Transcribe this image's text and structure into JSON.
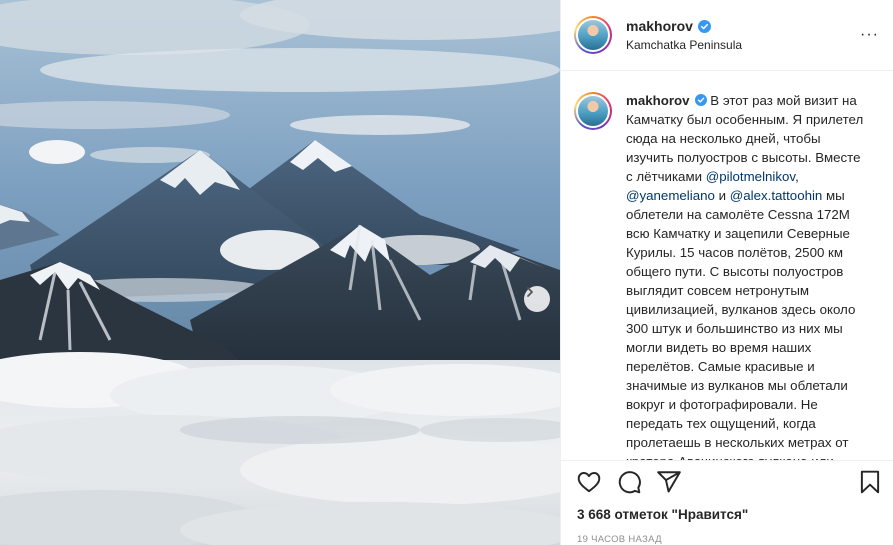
{
  "post": {
    "username": "makhorov",
    "location": "Kamchatka Peninsula",
    "caption_username": "makhorov",
    "caption_parts": [
      "В этот раз мой визит на Камчатку был особенным. Я прилетел сюда на несколько дней, чтобы изучить полуостров с высоты. Вместе с лётчиками ",
      "@pilotmelnikov",
      ", ",
      "@yanemeliano",
      " и ",
      "@alex.tattoohin",
      " мы облетели на самолёте Cessna 172M всю Камчатку и зацепили Северные Курилы. 15 часов полётов, 2500 км общего пути. С высоты полуостров выглядит совсем нетронутым цивилизацией, вулканов здесь около 300 штук и большинство из них мы могли видеть во время наших перелётов. Самые красивые и значимые из вулканов мы облетали вокруг и фотографировали. Не передать тех ощущений, когда пролетаешь в нескольких метрах от кратера Авачинского вулкана или"
    ],
    "likes_text": "3 668 отметок \"Нравится\"",
    "time_text": "19 часов назад"
  },
  "icons": {
    "verified": "verified-badge-icon",
    "like": "heart-icon",
    "comment": "comment-icon",
    "share": "share-icon",
    "save": "bookmark-icon",
    "next": "chevron-right-icon"
  },
  "colors": {
    "verified": "#3897f0",
    "mention": "#00376b",
    "muted": "#8e8e8e"
  }
}
